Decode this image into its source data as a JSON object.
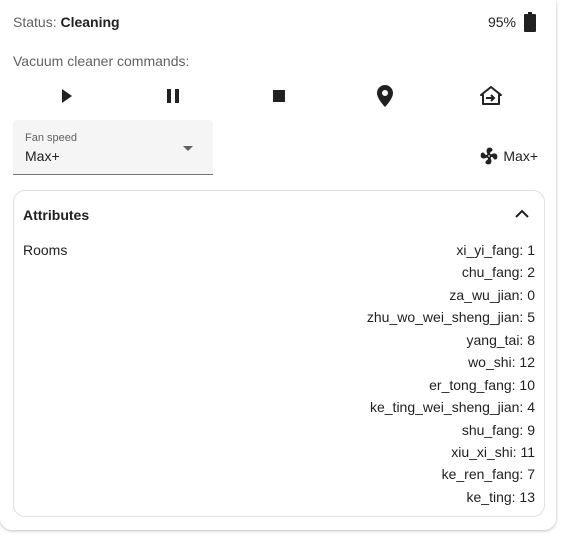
{
  "status": {
    "label": "Status:",
    "value": "Cleaning"
  },
  "battery": {
    "level": "95%",
    "icon": "battery-icon"
  },
  "commands": {
    "title": "Vacuum cleaner commands:",
    "buttons": [
      {
        "name": "start",
        "icon": "play-icon"
      },
      {
        "name": "pause",
        "icon": "pause-icon"
      },
      {
        "name": "stop",
        "icon": "stop-icon"
      },
      {
        "name": "locate",
        "icon": "map-marker-icon"
      },
      {
        "name": "return-home",
        "icon": "home-import-icon"
      }
    ]
  },
  "fan_speed": {
    "label": "Fan speed",
    "value": "Max+",
    "info_value": "Max+",
    "icon": "fan-icon"
  },
  "attributes": {
    "title": "Attributes",
    "rooms_label": "Rooms",
    "rooms": [
      "xi_yi_fang: 1",
      "chu_fang: 2",
      "za_wu_jian: 0",
      "zhu_wo_wei_sheng_jian: 5",
      "yang_tai: 8",
      "wo_shi: 12",
      "er_tong_fang: 10",
      "ke_ting_wei_sheng_jian: 4",
      "shu_fang: 9",
      "xiu_xi_shi: 11",
      "ke_ren_fang: 7",
      "ke_ting: 13"
    ]
  },
  "colors": {
    "text": "#212121",
    "secondary": "#616161",
    "field_bg": "#f5f5f5",
    "border": "#e0e0e0"
  }
}
